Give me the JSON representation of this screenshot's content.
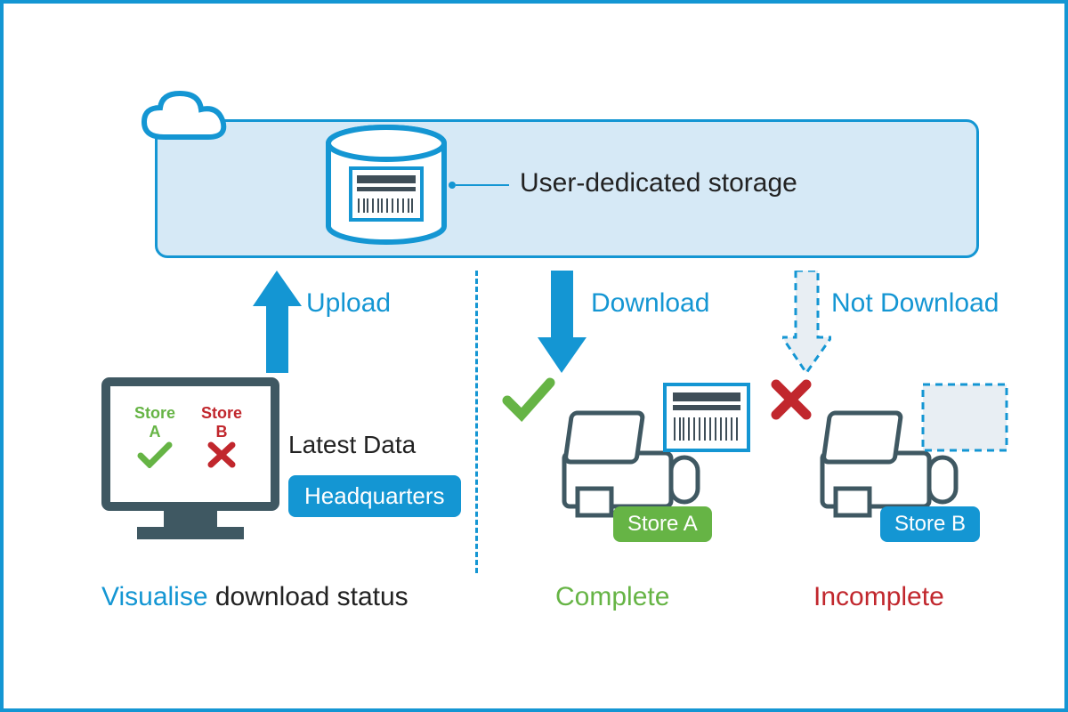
{
  "cloud": {
    "storage_label": "User-dedicated storage"
  },
  "arrows": {
    "upload": "Upload",
    "download": "Download",
    "not_download": "Not Download"
  },
  "hq": {
    "monitor": {
      "store_a_label": "Store\nA",
      "store_b_label": "Store\nB"
    },
    "latest_data": "Latest Data",
    "badge": "Headquarters",
    "caption_word1": "Visualise",
    "caption_rest": " download status"
  },
  "store_a": {
    "badge": "Store A",
    "status": "Complete"
  },
  "store_b": {
    "badge": "Store B",
    "status": "Incomplete"
  }
}
